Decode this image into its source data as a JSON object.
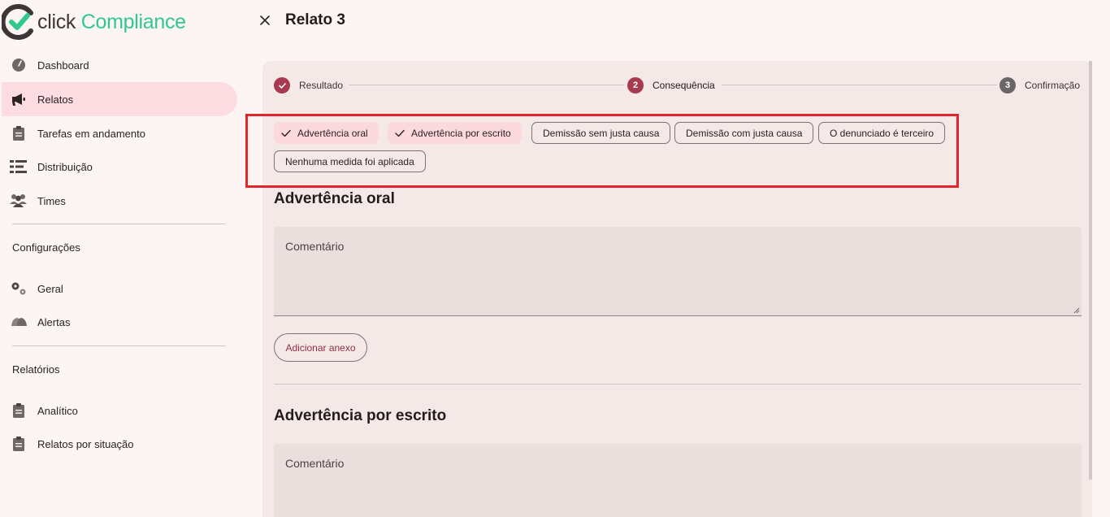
{
  "app": {
    "logo_click": "click",
    "logo_compliance": "Compliance"
  },
  "sidebar": {
    "items": [
      {
        "label": "Dashboard",
        "icon": "dashboard-gauge-icon",
        "active": false
      },
      {
        "label": "Relatos",
        "icon": "megaphone-icon",
        "active": true
      },
      {
        "label": "Tarefas em andamento",
        "icon": "clipboard-icon",
        "active": false
      },
      {
        "label": "Distribuição",
        "icon": "list-distribution-icon",
        "active": false
      },
      {
        "label": "Times",
        "icon": "people-icon",
        "active": false
      }
    ],
    "config_title": "Configurações",
    "config_items": [
      {
        "label": "Geral",
        "icon": "gears-icon"
      },
      {
        "label": "Alertas",
        "icon": "bells-icon"
      }
    ],
    "reports_title": "Relatórios",
    "report_items": [
      {
        "label": "Analítico",
        "icon": "clipboard-icon"
      },
      {
        "label": "Relatos por situação",
        "icon": "clipboard-icon"
      }
    ]
  },
  "header": {
    "title": "Relato 3"
  },
  "stepper": {
    "steps": [
      {
        "number": "1",
        "label": "Resultado",
        "state": "done"
      },
      {
        "number": "2",
        "label": "Consequência",
        "state": "current"
      },
      {
        "number": "3",
        "label": "Confirmação",
        "state": "todo"
      }
    ]
  },
  "consequences": {
    "options": [
      {
        "label": "Advertência oral",
        "selected": true
      },
      {
        "label": "Advertência por escrito",
        "selected": true
      },
      {
        "label": "Demissão sem justa causa",
        "selected": false
      },
      {
        "label": "Demissão com justa causa",
        "selected": false
      },
      {
        "label": "O denunciado é terceiro",
        "selected": false
      },
      {
        "label": "Nenhuma medida foi aplicada",
        "selected": false
      }
    ]
  },
  "sections": [
    {
      "title": "Advertência oral",
      "comment_placeholder": "Comentário",
      "attach_label": "Adicionar anexo"
    },
    {
      "title": "Advertência por escrito",
      "comment_placeholder": "Comentário"
    }
  ],
  "colors": {
    "accent": "#a83a4f",
    "selected_chip": "#fbd9dd",
    "highlight_frame": "#e3242b",
    "logo_green": "#2fc98d"
  }
}
